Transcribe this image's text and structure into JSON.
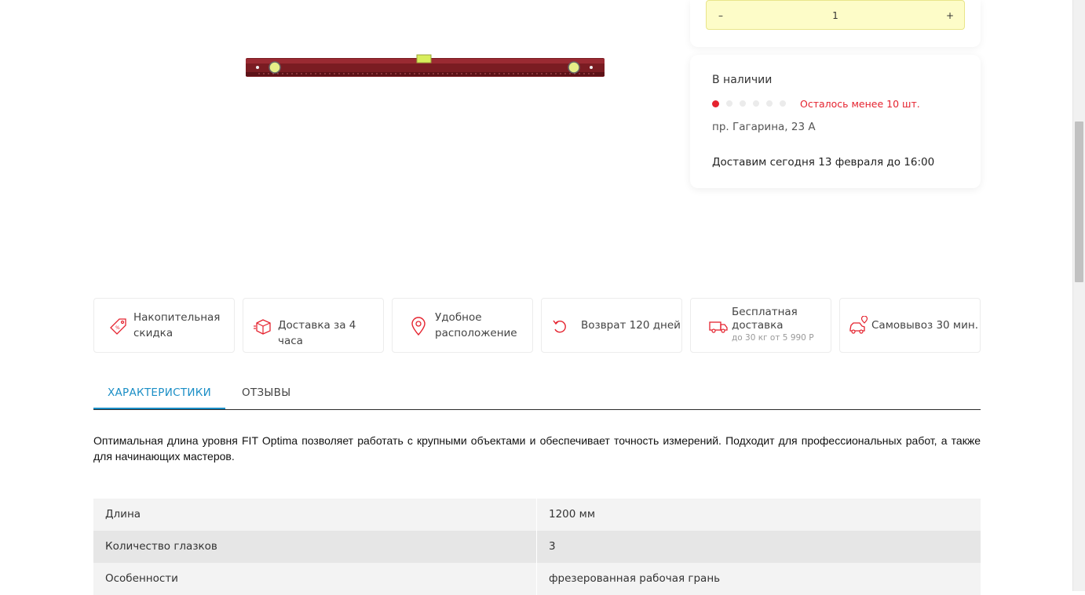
{
  "quantity": {
    "minus": "–",
    "value": "1",
    "plus": "+"
  },
  "availability": {
    "title": "В наличии",
    "stock_level": {
      "filled": 1,
      "total": 6
    },
    "stock_left": "Осталось менее 10 шт.",
    "address": "пр. Гагарина, 23 А",
    "delivery": "Доставим сегодня 13 февраля до 16:00"
  },
  "benefits": [
    {
      "label": "Накопительная скидка",
      "icon": "discount-tag-icon"
    },
    {
      "label": "Доставка за 4 часа",
      "icon": "package-box-icon"
    },
    {
      "label": "Удобное расположение",
      "icon": "map-pin-icon"
    },
    {
      "label": "Возврат 120 дней",
      "icon": "return-arrow-icon"
    },
    {
      "label": "Бесплатная доставка",
      "sub": "до 30 кг от 5 990 Р",
      "icon": "delivery-truck-icon"
    },
    {
      "label": "Самовывоз 30 мин.",
      "icon": "car-pickup-icon"
    }
  ],
  "tabs": [
    {
      "label": "ХАРАКТЕРИСТИКИ",
      "active": true
    },
    {
      "label": "ОТЗЫВЫ",
      "active": false
    }
  ],
  "description": "Оптимальная длина уровня FIT Optima позволяет работать с крупными объектами и обеспечивает точность измерений. Подходит для профессиональных работ, а также для начинающих мастеров.",
  "specs": [
    {
      "name": "Длина",
      "value": "1200 мм"
    },
    {
      "name": "Количество глазков",
      "value": "3"
    },
    {
      "name": "Особенности",
      "value": "фрезерованная рабочая грань"
    }
  ],
  "colors": {
    "accent_red": "#e5232f",
    "tab_blue": "#1a8ec6",
    "qty_bg": "#fdfcc8"
  }
}
